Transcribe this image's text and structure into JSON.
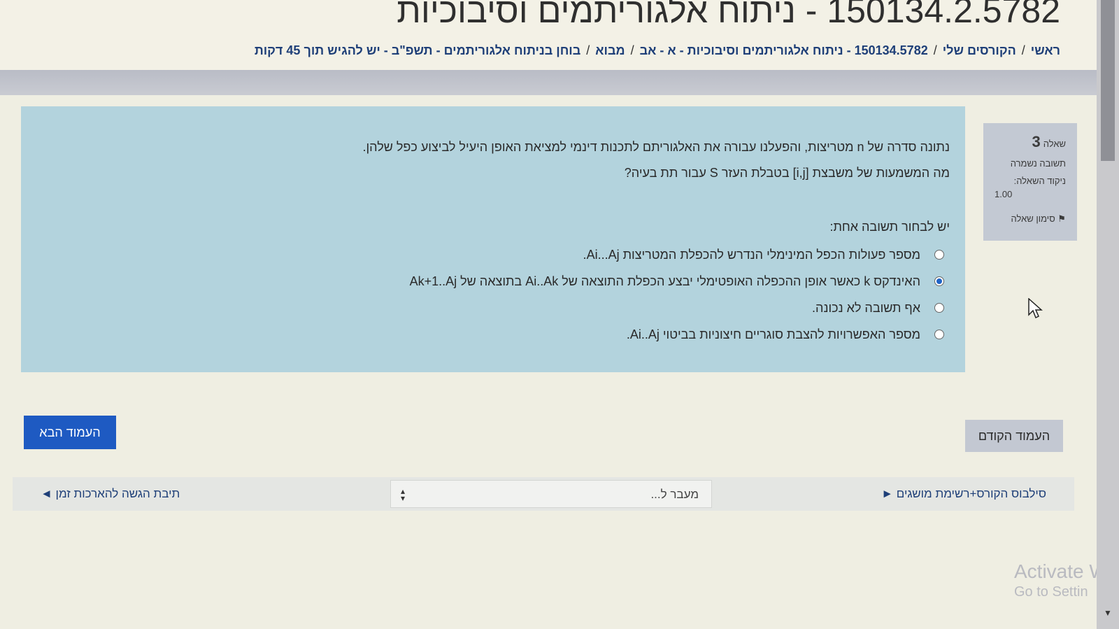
{
  "header": {
    "course_title": "150134.2.5782 - ניתוח אלגוריתמים וסיבוכיות",
    "breadcrumb": [
      "ראשי",
      "הקורסים שלי",
      "150134.5782 - ניתוח אלגוריתמים וסיבוכיות - א - אב",
      "מבוא",
      "בוחן בניתוח אלגוריתמים - תשפ\"ב - יש להגיש תוך 45 דקות"
    ]
  },
  "question_info": {
    "label": "שאלה",
    "number": "3",
    "status": "תשובה נשמרה",
    "grade_label": "ניקוד השאלה:",
    "grade_value": "1.00",
    "flag_label": "סימון שאלה"
  },
  "question": {
    "text_line1": "נתונה סדרה של n מטריצות, והפעלנו עבורה את האלגוריתם לתכנות דינמי למציאת האופן היעיל לביצוע כפל שלהן.",
    "text_line2": "מה המשמעות של משבצת [i,j] בטבלת העזר S עבור תת בעיה?",
    "answer_prompt": "יש לבחור תשובה אחת:",
    "options": [
      {
        "label": "מספר פעולות הכפל המינימלי הנדרש להכפלת המטריצות Ai...Aj.",
        "selected": false
      },
      {
        "label": "האינדקס k כאשר אופן ההכפלה האופטימלי יבצע הכפלת התוצאה של Ai..Ak בתוצאה של Ak+1..Aj",
        "selected": true
      },
      {
        "label": "אף תשובה לא נכונה.",
        "selected": false
      },
      {
        "label": "מספר האפשרויות להצבת סוגריים חיצוניות בביטוי Ai..Aj.",
        "selected": false
      }
    ]
  },
  "buttons": {
    "next": "העמוד הבא",
    "prev": "העמוד הקודם"
  },
  "nav": {
    "right_link": "סילבוס הקורס+רשימת מושגים ►",
    "jump_label": "מעבר ל...",
    "left_link": "תיבת הגשה להארכות זמן ◄"
  },
  "watermark": {
    "line1": "Activate W",
    "line2": "Go to Settin"
  },
  "colors": {
    "question_panel": "#b3d3dd",
    "next_button": "#1e5ac2",
    "link": "#1e3f78"
  }
}
